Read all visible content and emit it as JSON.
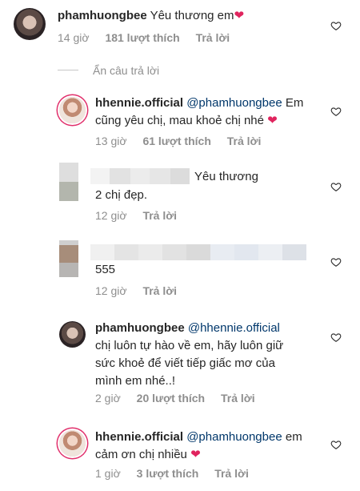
{
  "comments": [
    {
      "user": "phamhuongbee",
      "mention": "",
      "lines": [
        "Yêu thương em"
      ],
      "heart": true,
      "time": "14 giờ",
      "likes": "181 lượt thích",
      "reply": "Trả lời"
    }
  ],
  "hide_replies": "Ẩn câu trả lời",
  "replies": [
    {
      "user": "hhennie.official",
      "mention": "@phamhuongbee",
      "line1_tail": "Em",
      "line2": "cũng yêu chị, mau khoẻ chị nhé",
      "heart": true,
      "time": "13 giờ",
      "likes": "61 lượt thích",
      "reply": "Trả lời"
    },
    {
      "user": "",
      "line1_tail": "Yêu thương",
      "line2": "2 chị đẹp.",
      "time": "12 giờ",
      "reply": "Trả lời"
    },
    {
      "user": "",
      "line2": "555",
      "time": "12 giờ",
      "reply": "Trả lời"
    },
    {
      "user": "phamhuongbee",
      "mention": "@hhennie.official",
      "line2": "chị luôn tự hào về em, hãy luôn giữ",
      "line3": "sức khoẻ để viết tiếp giấc mơ của",
      "line4": "mình em nhé..!",
      "time": "2 giờ",
      "likes": "20 lượt thích",
      "reply": "Trả lời"
    },
    {
      "user": "hhennie.official",
      "mention": "@phamhuongbee",
      "line1_tail": "em",
      "line2": "cảm ơn chị nhiều",
      "heart": true,
      "time": "1 giờ",
      "likes": "3 lượt thích",
      "reply": "Trả lời"
    }
  ],
  "icons": {
    "heart_outline": "heart-outline-icon",
    "heart_filled": "red-heart-emoji"
  },
  "colors": {
    "mention": "#00376b",
    "meta": "#8e8e8e",
    "heart": "#e0245e"
  }
}
